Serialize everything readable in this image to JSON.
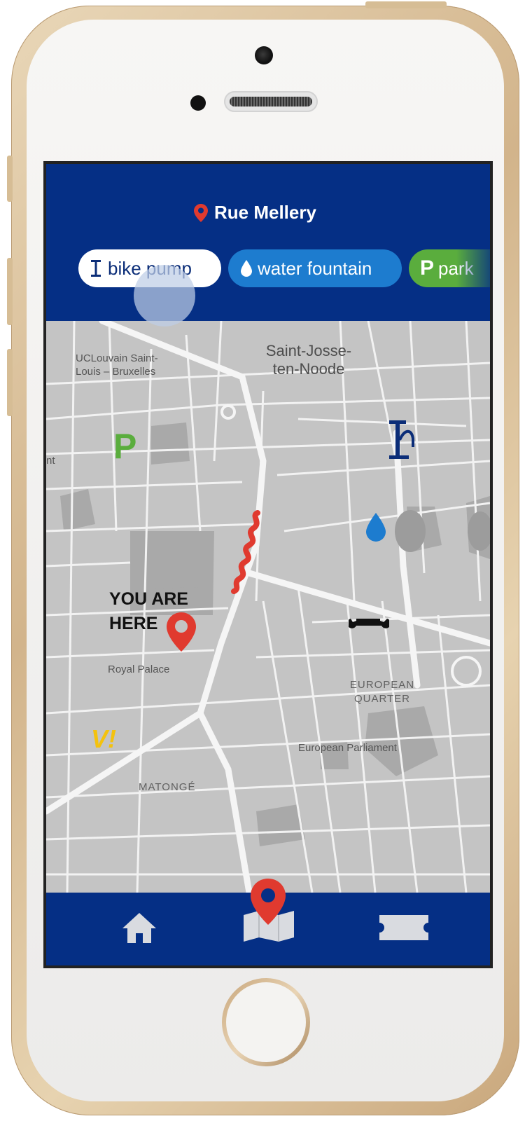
{
  "header": {
    "location": "Rue Mellery"
  },
  "filters": [
    {
      "label": "bike pump",
      "icon": "bike-pump-icon"
    },
    {
      "label": "water fountain",
      "icon": "water-drop-icon"
    },
    {
      "label": "park",
      "icon": "parking-icon"
    }
  ],
  "map": {
    "labels": {
      "uclouvain": "UCLouvain Saint-\nLouis – Bruxelles",
      "saint_josse": "Saint-Josse-\nten-Noode",
      "royal_palace": "Royal Palace",
      "european_quarter": "EUROPEAN\nQUARTER",
      "european_parliament": "European Parliament",
      "matonge": "MATONGÉ",
      "edge_fragment": "nt"
    },
    "you_are_here": "YOU ARE\nHERE",
    "markers": [
      "parking-icon",
      "bike-pump-icon",
      "water-drop-icon",
      "wrench-icon",
      "villo-icon",
      "road-hazard-icon",
      "location-pin-icon"
    ],
    "villo_text": "V!",
    "parking_letter": "P"
  },
  "nav": {
    "items": [
      "home-icon",
      "map-icon",
      "ticket-icon"
    ]
  },
  "colors": {
    "navy": "#052f85",
    "red": "#e03a2f",
    "green": "#5aad3d",
    "blue": "#1d7ccf",
    "yellow": "#f4c20d"
  }
}
